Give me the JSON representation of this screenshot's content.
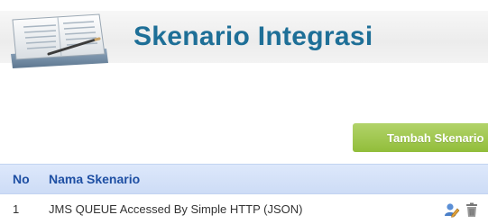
{
  "header": {
    "title": "Skenario Integrasi",
    "icon": "document-pencil-icon"
  },
  "toolbar": {
    "add_label": "Tambah Skenario"
  },
  "table": {
    "columns": [
      "No",
      "Nama Skenario"
    ],
    "rows": [
      {
        "no": "1",
        "name": "JMS QUEUE Accessed By Simple HTTP (JSON)",
        "actions": [
          "edit-user-icon",
          "trash-icon"
        ]
      }
    ]
  },
  "colors": {
    "title": "#1e6f97",
    "button": "#9cc548",
    "table_header_bg": "#d5e2f8",
    "table_header_text": "#1e4fa3"
  }
}
